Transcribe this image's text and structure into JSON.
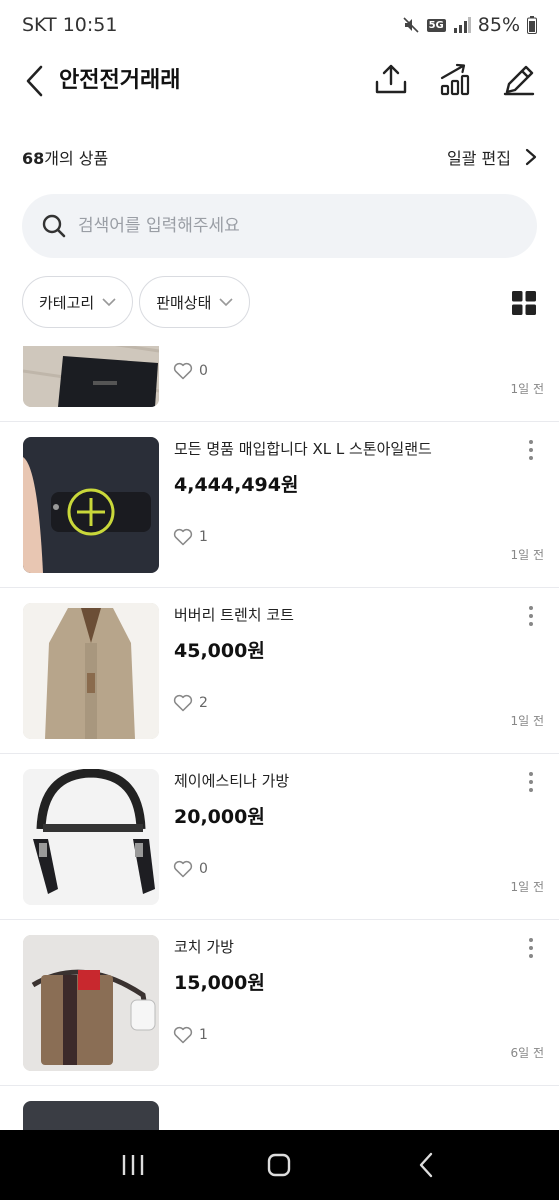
{
  "status_bar": {
    "carrier_time": "SKT 10:51",
    "network": "5G",
    "battery": "85%"
  },
  "header": {
    "title": "안전전거래래"
  },
  "summary": {
    "count_number": "68",
    "count_suffix": "개의 상품",
    "bulk_edit_label": "일괄 편집"
  },
  "search": {
    "placeholder": "검색어를 입력해주세요"
  },
  "filters": {
    "category": "카테고리",
    "sale_status": "판매상태"
  },
  "items": [
    {
      "title": "",
      "price": "",
      "likes": "0",
      "time": "1일 전",
      "thumb": "wallet"
    },
    {
      "title": "모든 명품 매입합니다 XL L 스톤아일랜드",
      "price": "4,444,494원",
      "likes": "1",
      "time": "1일 전",
      "thumb": "jacket"
    },
    {
      "title": "버버리 트렌치 코트",
      "price": "45,000원",
      "likes": "2",
      "time": "1일 전",
      "thumb": "coat"
    },
    {
      "title": "제이에스티나 가방",
      "price": "20,000원",
      "likes": "0",
      "time": "1일 전",
      "thumb": "bag"
    },
    {
      "title": "코치 가방",
      "price": "15,000원",
      "likes": "1",
      "time": "6일 전",
      "thumb": "coach"
    },
    {
      "title": "",
      "price": "",
      "likes": "",
      "time": "",
      "thumb": "partial"
    }
  ],
  "colors": {
    "search_bg": "#f1f3f6",
    "divider": "#e9eaee",
    "nav_bg": "#000000"
  }
}
